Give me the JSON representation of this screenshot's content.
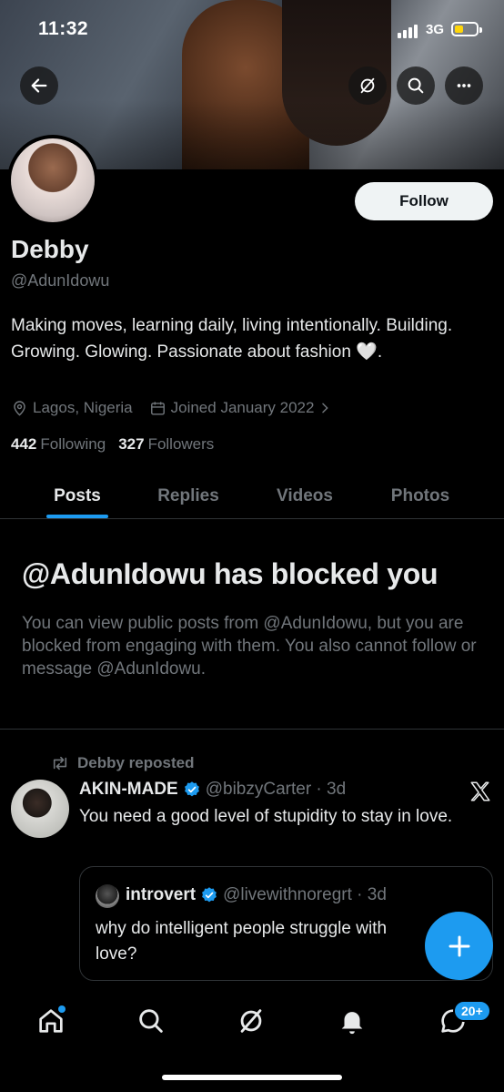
{
  "status_bar": {
    "time": "11:32",
    "network": "3G"
  },
  "profile": {
    "follow_label": "Follow",
    "name": "Debby",
    "handle": "@AdunIdowu",
    "bio": "Making moves, learning daily, living intentionally. Building. Growing. Glowing. Passionate about fashion 🤍.",
    "location": "Lagos, Nigeria",
    "joined": "Joined January 2022",
    "following_count": "442",
    "following_label": "Following",
    "followers_count": "327",
    "followers_label": "Followers"
  },
  "tabs": [
    {
      "label": "Posts",
      "active": true
    },
    {
      "label": "Replies"
    },
    {
      "label": "Videos"
    },
    {
      "label": "Photos"
    }
  ],
  "blocked": {
    "title": "@AdunIdowu has blocked you",
    "text": "You can view public posts from @AdunIdowu, but you are blocked from engaging with them. You also cannot follow or message @AdunIdowu."
  },
  "tweet": {
    "repost_label": "Debby reposted",
    "display_name": "AKIN-MADE",
    "handle_time": "@bibzyCarter · 3d",
    "text": "You need a good level of stupidity to stay in love.",
    "quote": {
      "display_name": "introvert",
      "handle_time": "@livewithnoregrt · 3d",
      "text": "why do intelligent people struggle with love?"
    }
  },
  "nav": {
    "messages_badge": "20+"
  },
  "colors": {
    "accent": "#1d9bf0",
    "background": "#000000",
    "muted": "#71767b"
  }
}
